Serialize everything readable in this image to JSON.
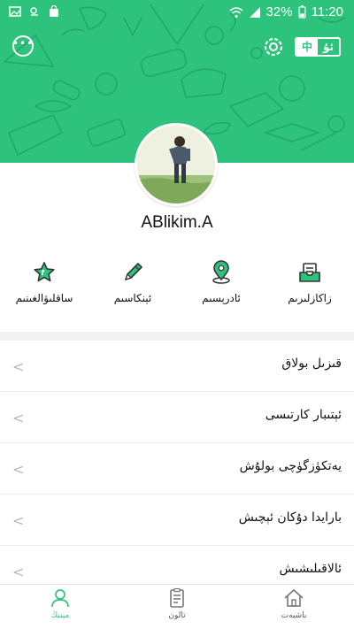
{
  "status_bar": {
    "battery_percent": "32%",
    "time": "11:20"
  },
  "header": {
    "lang_toggle": {
      "chinese": "中",
      "uyghur": "ئۇ"
    }
  },
  "profile": {
    "username": "ABlikim.A"
  },
  "quick_actions": [
    {
      "label": "زاكازلىرىم",
      "icon": "orders-icon"
    },
    {
      "label": "ئادرېسىم",
      "icon": "location-pin-icon"
    },
    {
      "label": "ئېنكاسىم",
      "icon": "pencil-icon"
    },
    {
      "label": "ساقلىۋالغىنىم",
      "icon": "star-icon"
    }
  ],
  "menu": [
    {
      "label": "قىزىل بولاق"
    },
    {
      "label": "ئېتىبار كارتىسى"
    },
    {
      "label": "يەتكۈزگۈچى بولۇش"
    },
    {
      "label": "بارايدا دۇكان ئېچىش"
    },
    {
      "label": "ئالاقىلىشىش"
    }
  ],
  "tabbar": [
    {
      "label": "باشبەت",
      "icon": "home-icon"
    },
    {
      "label": "تالون",
      "icon": "coupon-icon"
    },
    {
      "label": "مېنىڭ",
      "icon": "user-icon",
      "active": true
    }
  ],
  "colors": {
    "accent": "#2ec37c",
    "pattern_line": "#1f9e62",
    "text_primary": "#111111",
    "divider": "#f2f2f2"
  }
}
